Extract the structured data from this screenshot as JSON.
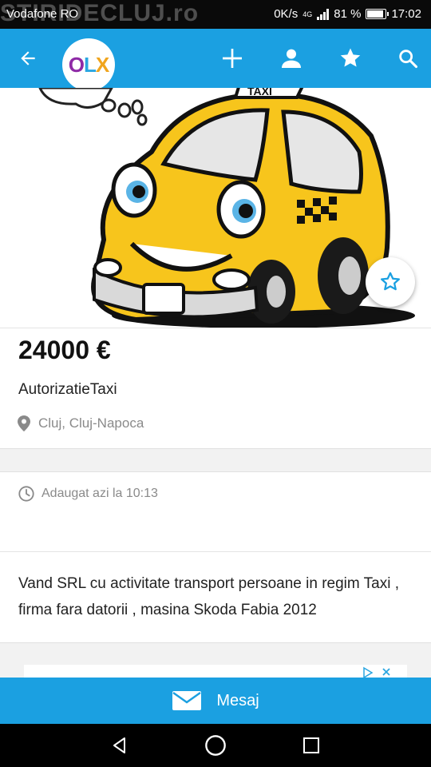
{
  "status_bar": {
    "watermark": "STIRIDECLUJ.ro",
    "carrier": "Vodafone RO",
    "speed": "0K/s",
    "network": "4G",
    "battery": "81 %",
    "time": "17:02"
  },
  "app_bar": {
    "logo_letters": [
      "O",
      "L",
      "X"
    ],
    "icons": [
      "back-arrow-icon",
      "plus-icon",
      "user-icon",
      "star-icon",
      "search-icon"
    ],
    "logo_colors": {
      "o": "#8e2aa6",
      "l": "#2aa6e1",
      "x": "#f0a51e"
    },
    "accent": "#1ba0e1"
  },
  "listing": {
    "price": "24000 €",
    "title": "AutorizatieTaxi",
    "location": "Cluj, Cluj-Napoca",
    "added": "Adaugat azi la 10:13",
    "description": "Vand SRL cu activitate transport persoane in regim Taxi , firma fara datorii , masina Skoda Fabia 2012"
  },
  "hero": {
    "sign_text": "TAXI"
  },
  "message_bar": {
    "label": "Mesaj",
    "icon": "envelope-icon"
  },
  "nav_bar": {
    "icons": [
      "back-triangle-icon",
      "home-circle-icon",
      "recents-square-icon"
    ]
  }
}
